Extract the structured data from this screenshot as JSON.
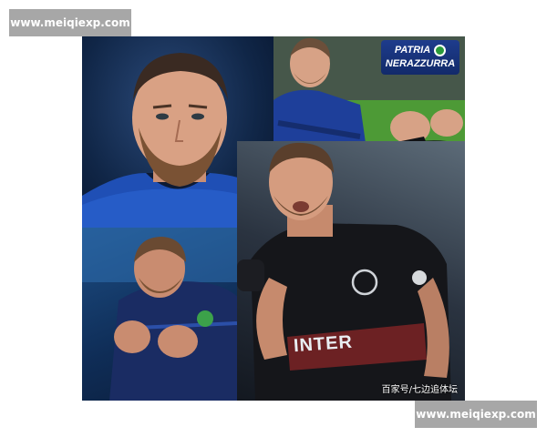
{
  "watermark_top": "www.meiqiexp.com",
  "watermark_bottom": "www.meiqiexp.com",
  "badge": {
    "line1": "PATRIA",
    "line2": "NERAZZURRA"
  },
  "jersey_text": "INTER",
  "credit": "百家号/七边追体坛",
  "colors": {
    "inter_blue": "#1e3c8c",
    "jersey_black": "#15161a",
    "watermark_bg": "#a7a7a7"
  }
}
